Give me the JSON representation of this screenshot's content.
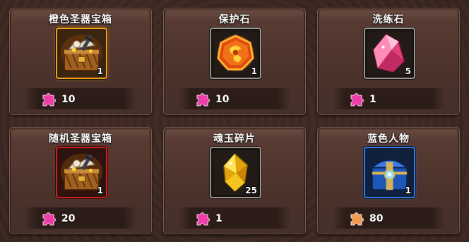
{
  "items": [
    {
      "title": "橙色圣器宝箱",
      "count": "1",
      "cost": "10",
      "frame": "orange",
      "icon": "treasure-chest-icon",
      "currency_icon": "puzzle-piece-icon"
    },
    {
      "title": "保护石",
      "count": "1",
      "cost": "10",
      "frame": "grey",
      "icon": "protection-stone-icon",
      "currency_icon": "puzzle-piece-icon"
    },
    {
      "title": "洗练石",
      "count": "5",
      "cost": "1",
      "frame": "grey",
      "icon": "pink-crystal-icon",
      "currency_icon": "puzzle-piece-icon"
    },
    {
      "title": "随机圣器宝箱",
      "count": "1",
      "cost": "20",
      "frame": "red",
      "icon": "treasure-chest-icon",
      "currency_icon": "puzzle-piece-icon"
    },
    {
      "title": "魂玉碎片",
      "count": "25",
      "cost": "1",
      "frame": "grey",
      "icon": "yellow-crystal-icon",
      "currency_icon": "puzzle-piece-icon"
    },
    {
      "title": "蓝色人物",
      "count": "1",
      "cost": "80",
      "frame": "blue",
      "icon": "blue-chest-icon",
      "currency_icon": "orange-puzzle-icon"
    }
  ],
  "colors": {
    "orange_frame": "#f6a416",
    "red_frame": "#d21e1e",
    "blue_frame": "#2f7be6",
    "puzzle_pink": "#f03ca8",
    "puzzle_orange": "#f29a52"
  }
}
